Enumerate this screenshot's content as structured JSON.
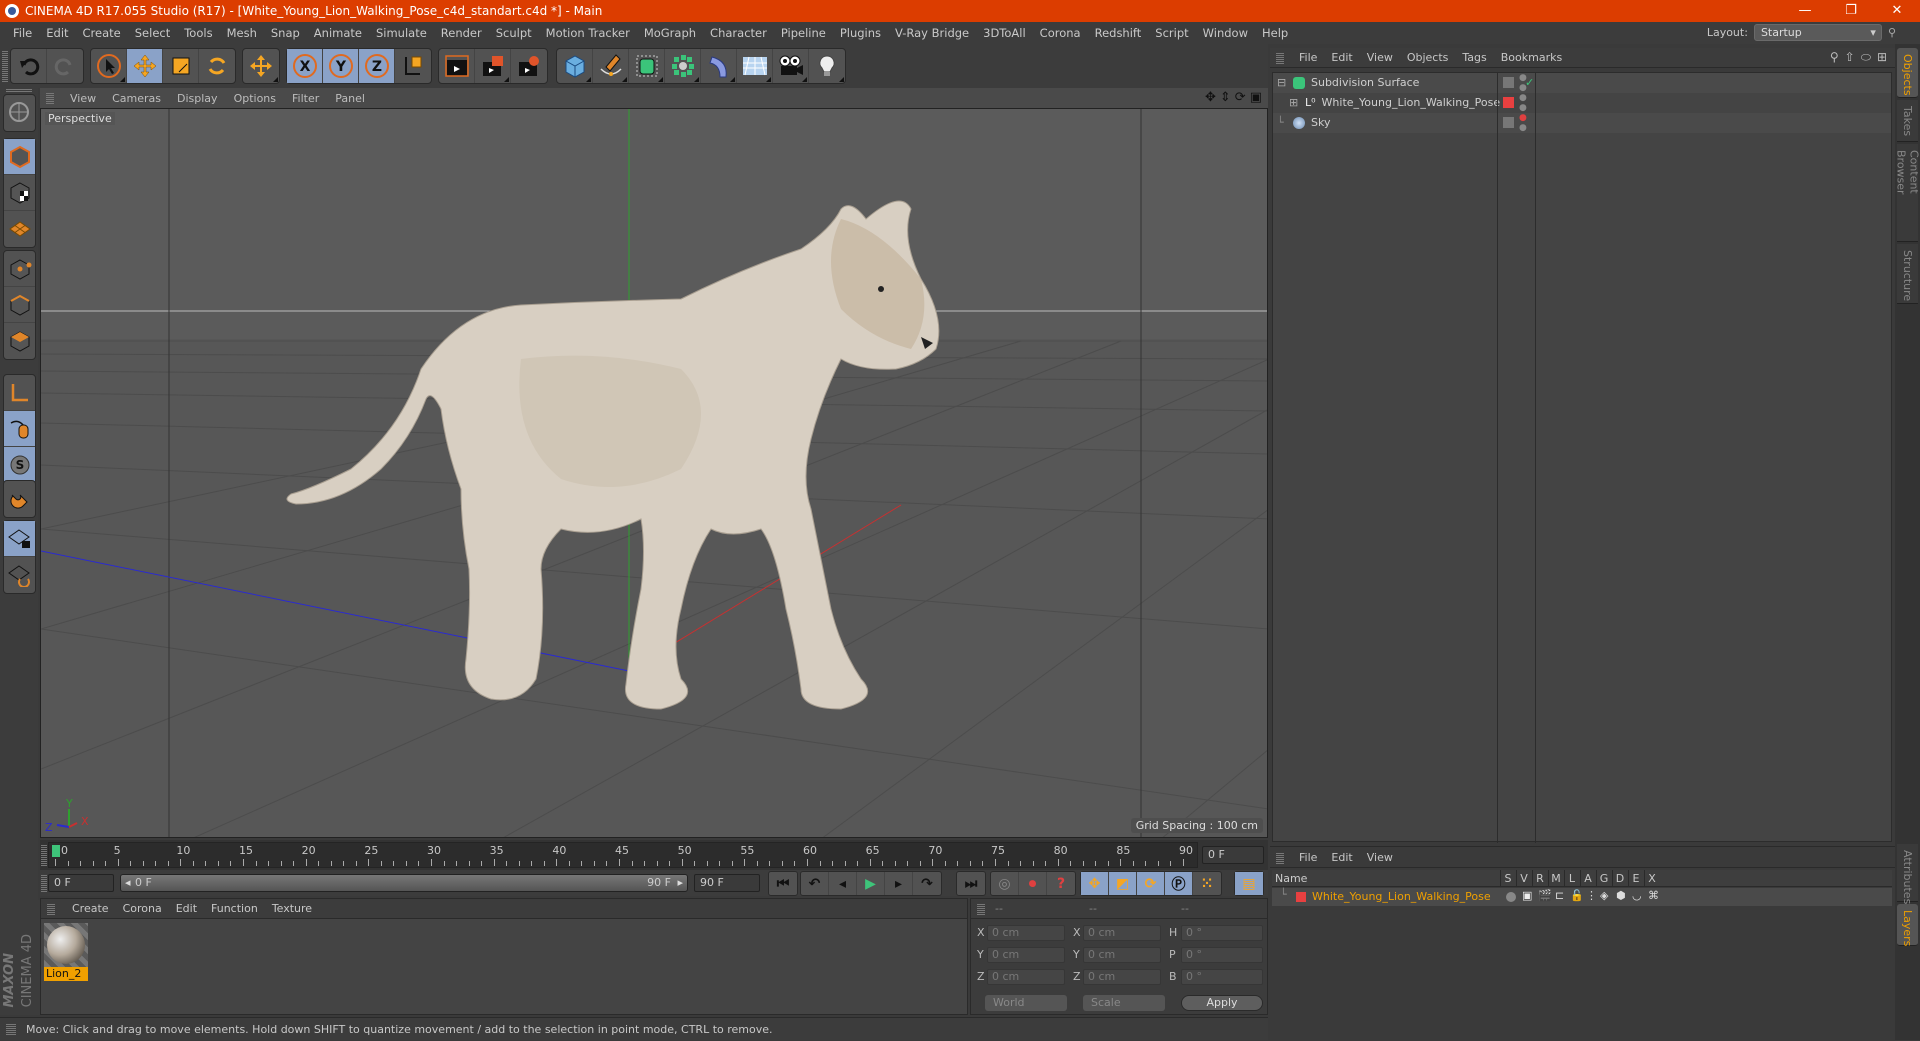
{
  "window": {
    "title": "CINEMA 4D R17.055 Studio (R17) - [White_Young_Lion_Walking_Pose_c4d_standart.c4d *] - Main",
    "controls": [
      "minimize-icon",
      "restore-icon",
      "close-icon"
    ],
    "minimize": "—",
    "restore": "❐",
    "close": "✕"
  },
  "menubar": {
    "items": [
      "File",
      "Edit",
      "Create",
      "Select",
      "Tools",
      "Mesh",
      "Snap",
      "Animate",
      "Simulate",
      "Render",
      "Sculpt",
      "Motion Tracker",
      "MoGraph",
      "Character",
      "Pipeline",
      "Plugins",
      "V-Ray Bridge",
      "3DToAll",
      "Corona",
      "Redshift",
      "Script",
      "Window",
      "Help"
    ],
    "layout_label": "Layout:",
    "layout_value": "Startup"
  },
  "toolbar": {
    "groups": [
      [
        "undo-icon",
        "redo-icon"
      ],
      [
        "select-icon",
        "move-icon",
        "scale-icon",
        "rotate-icon"
      ],
      [
        "last-tool-icon"
      ],
      [
        "x-axis-icon",
        "y-axis-icon",
        "z-axis-icon",
        "coordinate-system-icon"
      ],
      [
        "render-view-icon",
        "render-picture-viewer-icon",
        "render-settings-icon"
      ],
      [
        "cube-icon",
        "pen-spline-icon",
        "subdivision-icon",
        "cloner-icon",
        "bend-deformer-icon",
        "floor-icon",
        "camera-icon",
        "light-icon"
      ]
    ],
    "axis_labels": [
      "X",
      "Y",
      "Z"
    ]
  },
  "left_tools": {
    "items": [
      "make-editable-icon",
      "model-mode-icon",
      "texture-mode-icon",
      "workplane-mode-icon",
      "points-mode-icon",
      "edges-mode-icon",
      "polygons-mode-icon",
      "axis-mode-icon",
      "tweak-mode-icon",
      "snap-icon",
      "magnet-icon",
      "lock-workplane-icon",
      "workplane-align-icon"
    ]
  },
  "viewport": {
    "menu": [
      "View",
      "Cameras",
      "Display",
      "Options",
      "Filter",
      "Panel"
    ],
    "label": "Perspective",
    "grid_spacing": "Grid Spacing : 100 cm",
    "axis_labels": {
      "x": "X",
      "y": "Y",
      "z": "Z"
    },
    "colors": {
      "x_axis": "#c83030",
      "y_axis": "#2fa02f",
      "z_axis": "#2a2ad0",
      "background": "#5b5b5b"
    }
  },
  "object_manager": {
    "menu": [
      "File",
      "Edit",
      "View",
      "Objects",
      "Tags",
      "Bookmarks"
    ],
    "objects": [
      {
        "name": "Subdivision Surface",
        "icon": "subdivision-icon",
        "tag": "check"
      },
      {
        "name": "White_Young_Lion_Walking_Pose",
        "icon": "null-object-icon",
        "layer_color": "#e84040"
      },
      {
        "name": "Sky",
        "icon": "sky-icon"
      }
    ]
  },
  "right_tabs": {
    "top": [
      "Objects",
      "Takes",
      "Content Browser",
      "Structure"
    ],
    "bottom": [
      "Attributes",
      "Layers"
    ],
    "active_top": "Objects",
    "active_bottom": "Layers"
  },
  "layer_manager": {
    "menu": [
      "File",
      "Edit",
      "View"
    ],
    "columns": [
      "Name",
      "S",
      "V",
      "R",
      "M",
      "L",
      "A",
      "G",
      "D",
      "E",
      "X"
    ],
    "layers": [
      {
        "name": "White_Young_Lion_Walking_Pose",
        "color": "#e84040"
      }
    ]
  },
  "timeline": {
    "ticks": [
      "0",
      "5",
      "10",
      "15",
      "20",
      "25",
      "30",
      "35",
      "40",
      "45",
      "50",
      "55",
      "60",
      "65",
      "70",
      "75",
      "80",
      "85",
      "90"
    ],
    "current_frame": "0 F",
    "start_frame": "0 F",
    "range_start": "0 F",
    "range_end": "90 F",
    "end_frame": "90 F",
    "min": 0,
    "max": 90,
    "playhead": 0
  },
  "playback": {
    "buttons": [
      "go-to-start-icon",
      "previous-key-icon",
      "previous-frame-icon",
      "play-icon",
      "next-frame-icon",
      "next-key-icon",
      "go-to-end-icon"
    ],
    "record_buttons": [
      "motion-record-icon",
      "record-active-icon",
      "autokey-icon"
    ],
    "key_buttons": [
      "key-position-icon",
      "key-scale-icon",
      "key-rotation-icon",
      "key-parameter-icon",
      "key-pla-icon"
    ],
    "timeline_button": "timeline-icon"
  },
  "material_manager": {
    "menu": [
      "Create",
      "Corona",
      "Edit",
      "Function",
      "Texture"
    ],
    "materials": [
      {
        "name": "Lion_2"
      }
    ]
  },
  "coordinates": {
    "headers": [
      "--",
      "--",
      "--"
    ],
    "rows": [
      {
        "pos_label": "X",
        "pos": "0 cm",
        "size_label": "X",
        "size": "0 cm",
        "rot_label": "H",
        "rot": "0 °"
      },
      {
        "pos_label": "Y",
        "pos": "0 cm",
        "size_label": "Y",
        "size": "0 cm",
        "rot_label": "P",
        "rot": "0 °"
      },
      {
        "pos_label": "Z",
        "pos": "0 cm",
        "size_label": "Z",
        "size": "0 cm",
        "rot_label": "B",
        "rot": "0 °"
      }
    ],
    "space": "World",
    "mode": "Scale",
    "apply": "Apply"
  },
  "brand": {
    "maxon": "MAXON",
    "cinema": "CINEMA 4D"
  },
  "status": "Move: Click and drag to move elements. Hold down SHIFT to quantize movement / add to the selection in point mode, CTRL to remove."
}
